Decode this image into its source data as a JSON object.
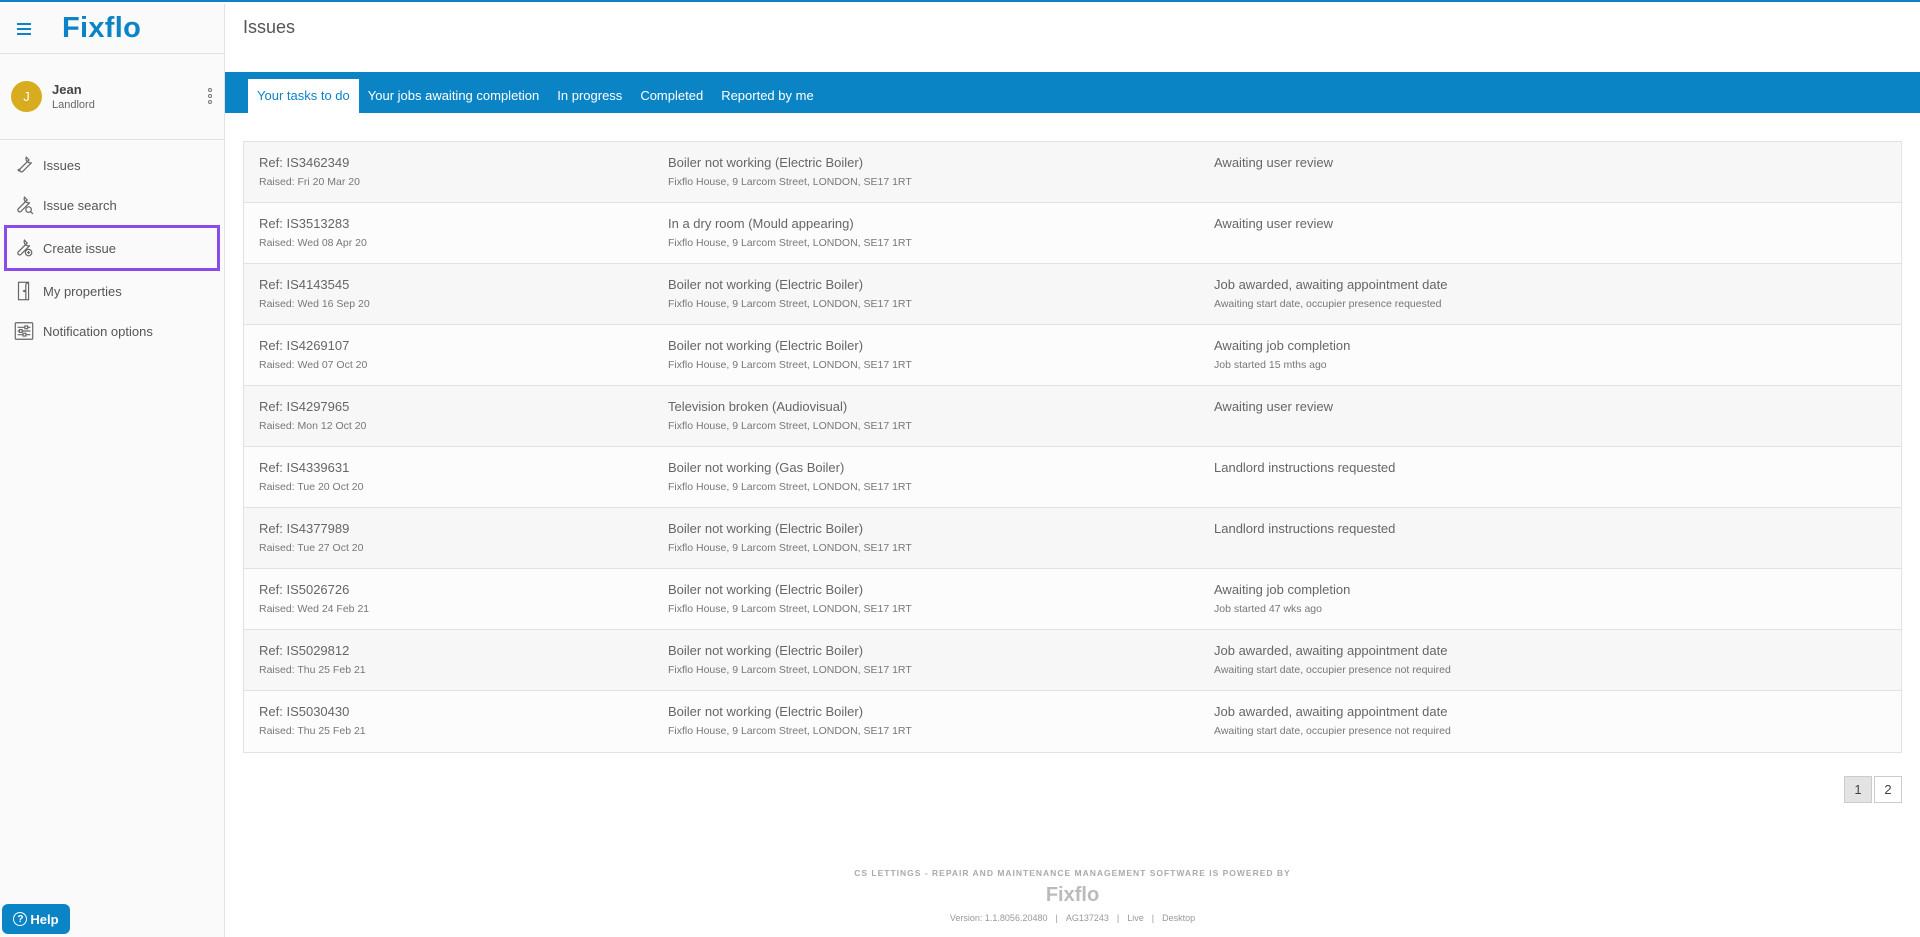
{
  "brand": {
    "logo": "Fixflo"
  },
  "user": {
    "initial": "J",
    "name": "Jean",
    "role": "Landlord"
  },
  "nav": [
    {
      "label": "Issues",
      "icon": "wrench-icon"
    },
    {
      "label": "Issue search",
      "icon": "wrench-search-icon"
    },
    {
      "label": "Create issue",
      "icon": "wrench-add-icon"
    },
    {
      "label": "My properties",
      "icon": "door-icon"
    },
    {
      "label": "Notification options",
      "icon": "sliders-icon"
    }
  ],
  "help": {
    "label": "Help"
  },
  "page": {
    "title": "Issues"
  },
  "tabs": [
    {
      "label": "Your tasks to do",
      "active": true
    },
    {
      "label": "Your jobs awaiting completion",
      "active": false
    },
    {
      "label": "In progress",
      "active": false
    },
    {
      "label": "Completed",
      "active": false
    },
    {
      "label": "Reported by me",
      "active": false
    }
  ],
  "issues": [
    {
      "ref": "Ref: IS3462349",
      "raised": "Raised: Fri 20 Mar 20",
      "title": "Boiler not working (Electric Boiler)",
      "address": "Fixflo House, 9 Larcom Street, LONDON, SE17 1RT",
      "status": "Awaiting user review",
      "status_detail": ""
    },
    {
      "ref": "Ref: IS3513283",
      "raised": "Raised: Wed 08 Apr 20",
      "title": "In a dry room (Mould appearing)",
      "address": "Fixflo House, 9 Larcom Street, LONDON, SE17 1RT",
      "status": "Awaiting user review",
      "status_detail": ""
    },
    {
      "ref": "Ref: IS4143545",
      "raised": "Raised: Wed 16 Sep 20",
      "title": "Boiler not working (Electric Boiler)",
      "address": "Fixflo House, 9 Larcom Street, LONDON, SE17 1RT",
      "status": "Job awarded, awaiting appointment date",
      "status_detail": "Awaiting start date, occupier presence requested"
    },
    {
      "ref": "Ref: IS4269107",
      "raised": "Raised: Wed 07 Oct 20",
      "title": "Boiler not working (Electric Boiler)",
      "address": "Fixflo House, 9 Larcom Street, LONDON, SE17 1RT",
      "status": "Awaiting job completion",
      "status_detail": "Job started 15 mths ago"
    },
    {
      "ref": "Ref: IS4297965",
      "raised": "Raised: Mon 12 Oct 20",
      "title": "Television broken (Audiovisual)",
      "address": "Fixflo House, 9 Larcom Street, LONDON, SE17 1RT",
      "status": "Awaiting user review",
      "status_detail": ""
    },
    {
      "ref": "Ref: IS4339631",
      "raised": "Raised: Tue 20 Oct 20",
      "title": "Boiler not working (Gas Boiler)",
      "address": "Fixflo House, 9 Larcom Street, LONDON, SE17 1RT",
      "status": "Landlord instructions requested",
      "status_detail": ""
    },
    {
      "ref": "Ref: IS4377989",
      "raised": "Raised: Tue 27 Oct 20",
      "title": "Boiler not working (Electric Boiler)",
      "address": "Fixflo House, 9 Larcom Street, LONDON, SE17 1RT",
      "status": "Landlord instructions requested",
      "status_detail": ""
    },
    {
      "ref": "Ref: IS5026726",
      "raised": "Raised: Wed 24 Feb 21",
      "title": "Boiler not working (Electric Boiler)",
      "address": "Fixflo House, 9 Larcom Street, LONDON, SE17 1RT",
      "status": "Awaiting job completion",
      "status_detail": "Job started 47 wks ago"
    },
    {
      "ref": "Ref: IS5029812",
      "raised": "Raised: Thu 25 Feb 21",
      "title": "Boiler not working (Electric Boiler)",
      "address": "Fixflo House, 9 Larcom Street, LONDON, SE17 1RT",
      "status": "Job awarded, awaiting appointment date",
      "status_detail": "Awaiting start date, occupier presence not required"
    },
    {
      "ref": "Ref: IS5030430",
      "raised": "Raised: Thu 25 Feb 21",
      "title": "Boiler not working (Electric Boiler)",
      "address": "Fixflo House, 9 Larcom Street, LONDON, SE17 1RT",
      "status": "Job awarded, awaiting appointment date",
      "status_detail": "Awaiting start date, occupier presence not required"
    }
  ],
  "pagination": {
    "pages": [
      "1",
      "2"
    ],
    "current": "1"
  },
  "footer": {
    "powered": "CS LETTINGS - REPAIR AND MAINTENANCE MANAGEMENT SOFTWARE IS POWERED BY",
    "logo": "Fixflo",
    "version": "Version: 1.1.8056.20480",
    "code": "AG137243",
    "env": "Live",
    "mode": "Desktop"
  },
  "colors": {
    "accent": "#0b84c6",
    "highlight": "#8b4bea",
    "avatar": "#d8ac1f"
  }
}
